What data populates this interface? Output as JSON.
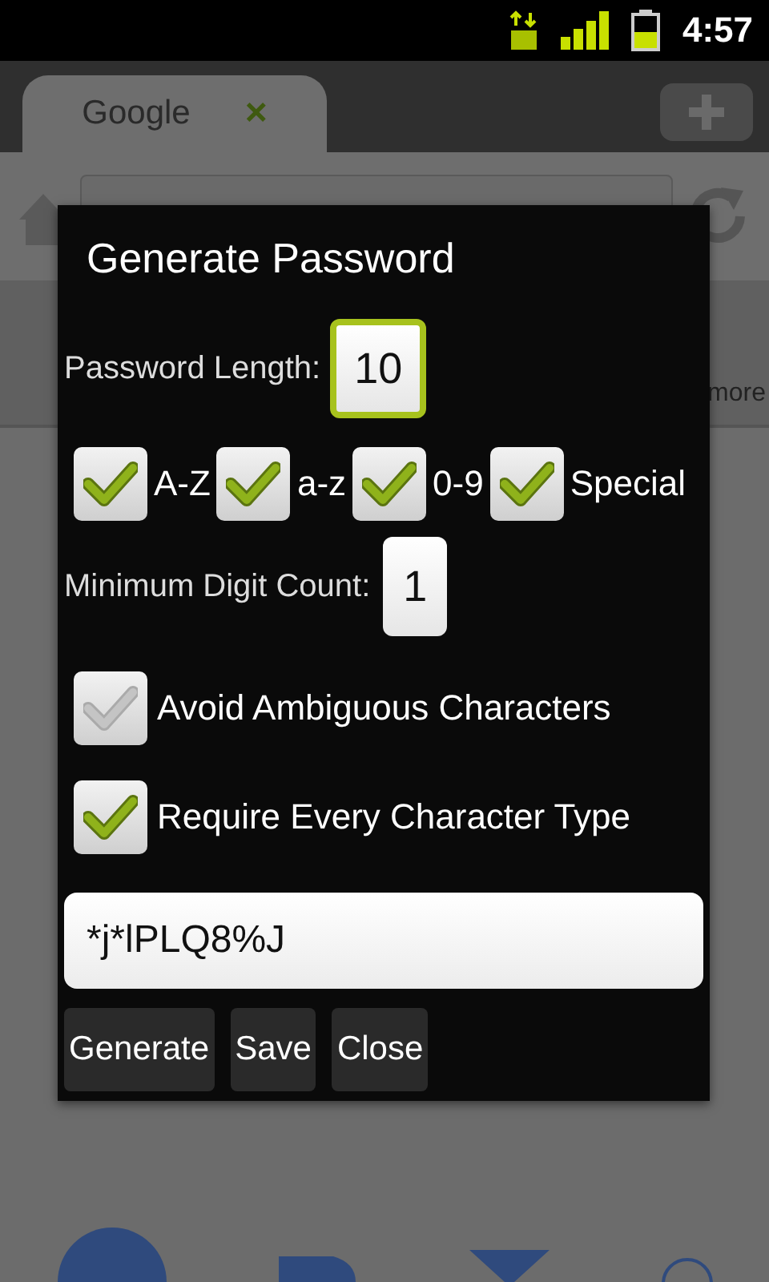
{
  "status_bar": {
    "time": "4:57"
  },
  "browser": {
    "tab": {
      "title": "Google",
      "close": "×"
    },
    "nav_items": [
      {
        "label": "more"
      }
    ]
  },
  "dialog": {
    "title": "Generate Password",
    "length": {
      "label": "Password Length:",
      "value": "10",
      "focused": true
    },
    "charsets": [
      {
        "label": "A-Z",
        "checked": true
      },
      {
        "label": "a-z",
        "checked": true
      },
      {
        "label": "0-9",
        "checked": true
      },
      {
        "label": "Special",
        "checked": true
      }
    ],
    "min_digits": {
      "label": "Minimum Digit Count:",
      "value": "1",
      "focused": false
    },
    "options": [
      {
        "label": "Avoid Ambiguous Characters",
        "checked": false
      },
      {
        "label": "Require Every Character Type",
        "checked": true
      }
    ],
    "password": "*j*lPLQ8%J",
    "buttons": [
      "Generate",
      "Save",
      "Close"
    ]
  }
}
